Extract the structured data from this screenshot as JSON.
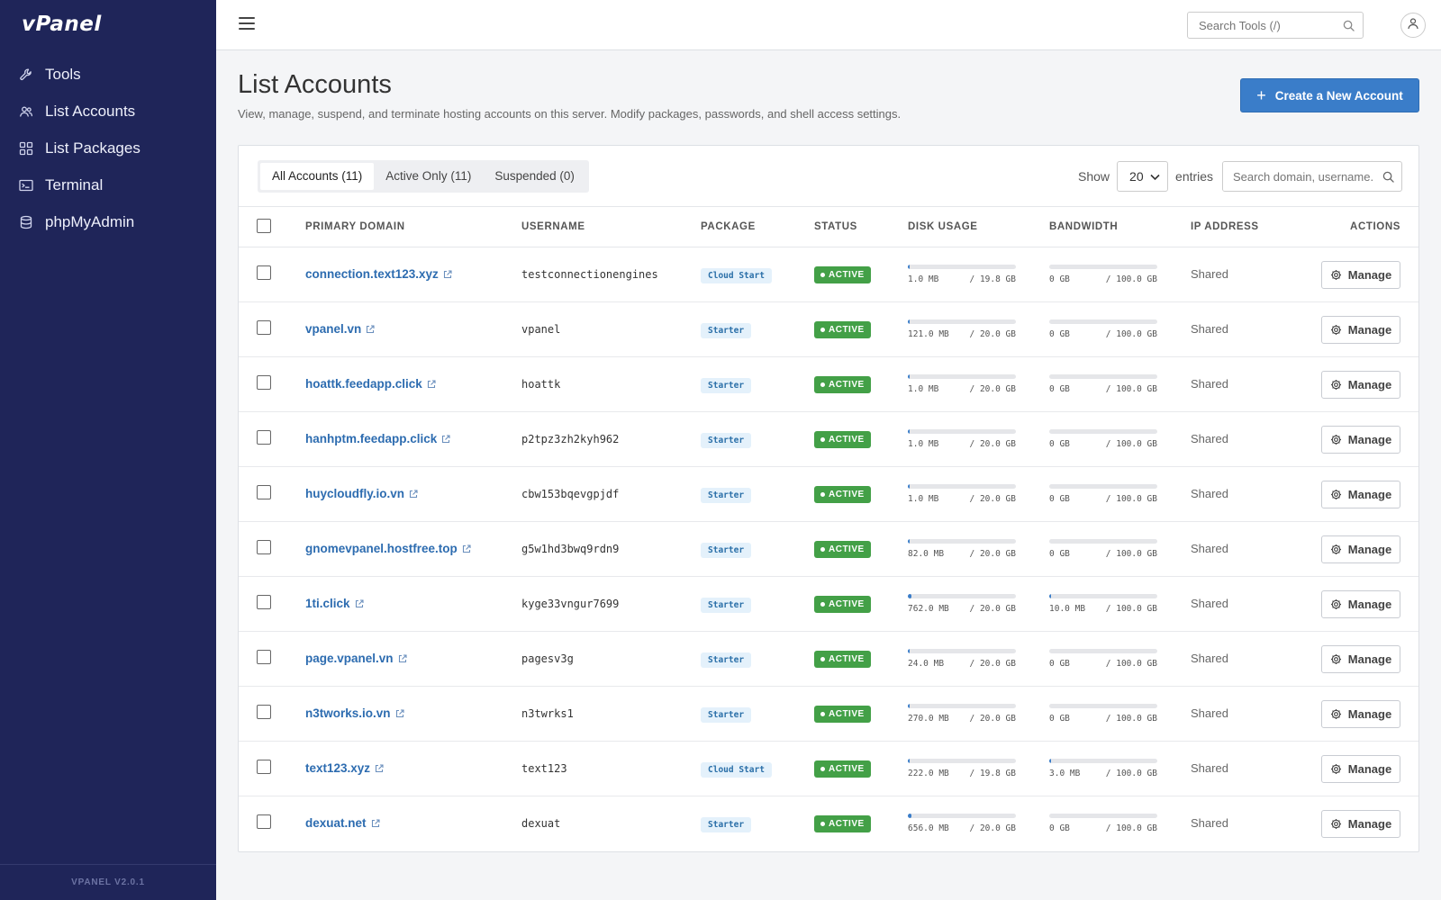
{
  "app": {
    "logo": "vPanel",
    "version": "VPANEL V2.0.1"
  },
  "sidebar": {
    "items": [
      {
        "label": "Tools",
        "icon": "wrench-icon"
      },
      {
        "label": "List Accounts",
        "icon": "users-icon"
      },
      {
        "label": "List Packages",
        "icon": "grid-icon"
      },
      {
        "label": "Terminal",
        "icon": "terminal-icon"
      },
      {
        "label": "phpMyAdmin",
        "icon": "database-icon"
      }
    ]
  },
  "topbar": {
    "search_placeholder": "Search Tools (/)"
  },
  "page": {
    "title": "List Accounts",
    "description": "View, manage, suspend, and terminate hosting accounts on this server. Modify packages, passwords, and shell access settings.",
    "create_button": "Create a New Account"
  },
  "tabs": [
    {
      "label": "All Accounts (11)",
      "active": true
    },
    {
      "label": "Active Only (11)",
      "active": false
    },
    {
      "label": "Suspended (0)",
      "active": false
    }
  ],
  "entries": {
    "show_label": "Show",
    "value": "20",
    "suffix": "entries"
  },
  "table_search": {
    "placeholder": "Search domain, username..."
  },
  "columns": [
    "PRIMARY DOMAIN",
    "USERNAME",
    "PACKAGE",
    "STATUS",
    "DISK USAGE",
    "BANDWIDTH",
    "IP ADDRESS",
    "ACTIONS"
  ],
  "rows": [
    {
      "domain": "connection.text123.xyz",
      "username": "testconnectionengines",
      "package": "Cloud Start",
      "status": "ACTIVE",
      "disk_used": "1.0 MB",
      "disk_limit": "/ 19.8 GB",
      "disk_frac": 0.0001,
      "bw_used": "0 GB",
      "bw_limit": "/ 100.0 GB",
      "bw_frac": 0,
      "ip": "Shared",
      "action": "Manage"
    },
    {
      "domain": "vpanel.vn",
      "username": "vpanel",
      "package": "Starter",
      "status": "ACTIVE",
      "disk_used": "121.0 MB",
      "disk_limit": "/ 20.0 GB",
      "disk_frac": 0.006,
      "bw_used": "0 GB",
      "bw_limit": "/ 100.0 GB",
      "bw_frac": 0,
      "ip": "Shared",
      "action": "Manage"
    },
    {
      "domain": "hoattk.feedapp.click",
      "username": "hoattk",
      "package": "Starter",
      "status": "ACTIVE",
      "disk_used": "1.0 MB",
      "disk_limit": "/ 20.0 GB",
      "disk_frac": 0.0001,
      "bw_used": "0 GB",
      "bw_limit": "/ 100.0 GB",
      "bw_frac": 0,
      "ip": "Shared",
      "action": "Manage"
    },
    {
      "domain": "hanhptm.feedapp.click",
      "username": "p2tpz3zh2kyh962",
      "package": "Starter",
      "status": "ACTIVE",
      "disk_used": "1.0 MB",
      "disk_limit": "/ 20.0 GB",
      "disk_frac": 0.0001,
      "bw_used": "0 GB",
      "bw_limit": "/ 100.0 GB",
      "bw_frac": 0,
      "ip": "Shared",
      "action": "Manage"
    },
    {
      "domain": "huycloudfly.io.vn",
      "username": "cbw153bqevgpjdf",
      "package": "Starter",
      "status": "ACTIVE",
      "disk_used": "1.0 MB",
      "disk_limit": "/ 20.0 GB",
      "disk_frac": 0.0001,
      "bw_used": "0 GB",
      "bw_limit": "/ 100.0 GB",
      "bw_frac": 0,
      "ip": "Shared",
      "action": "Manage"
    },
    {
      "domain": "gnomevpanel.hostfree.top",
      "username": "g5w1hd3bwq9rdn9",
      "package": "Starter",
      "status": "ACTIVE",
      "disk_used": "82.0 MB",
      "disk_limit": "/ 20.0 GB",
      "disk_frac": 0.004,
      "bw_used": "0 GB",
      "bw_limit": "/ 100.0 GB",
      "bw_frac": 0,
      "ip": "Shared",
      "action": "Manage"
    },
    {
      "domain": "1ti.click",
      "username": "kyge33vngur7699",
      "package": "Starter",
      "status": "ACTIVE",
      "disk_used": "762.0 MB",
      "disk_limit": "/ 20.0 GB",
      "disk_frac": 0.037,
      "bw_used": "10.0 MB",
      "bw_limit": "/ 100.0 GB",
      "bw_frac": 0.0001,
      "ip": "Shared",
      "action": "Manage"
    },
    {
      "domain": "page.vpanel.vn",
      "username": "pagesv3g",
      "package": "Starter",
      "status": "ACTIVE",
      "disk_used": "24.0 MB",
      "disk_limit": "/ 20.0 GB",
      "disk_frac": 0.0012,
      "bw_used": "0 GB",
      "bw_limit": "/ 100.0 GB",
      "bw_frac": 0,
      "ip": "Shared",
      "action": "Manage"
    },
    {
      "domain": "n3tworks.io.vn",
      "username": "n3twrks1",
      "package": "Starter",
      "status": "ACTIVE",
      "disk_used": "270.0 MB",
      "disk_limit": "/ 20.0 GB",
      "disk_frac": 0.013,
      "bw_used": "0 GB",
      "bw_limit": "/ 100.0 GB",
      "bw_frac": 0,
      "ip": "Shared",
      "action": "Manage"
    },
    {
      "domain": "text123.xyz",
      "username": "text123",
      "package": "Cloud Start",
      "status": "ACTIVE",
      "disk_used": "222.0 MB",
      "disk_limit": "/ 19.8 GB",
      "disk_frac": 0.011,
      "bw_used": "3.0 MB",
      "bw_limit": "/ 100.0 GB",
      "bw_frac": 3e-05,
      "ip": "Shared",
      "action": "Manage"
    },
    {
      "domain": "dexuat.net",
      "username": "dexuat",
      "package": "Starter",
      "status": "ACTIVE",
      "disk_used": "656.0 MB",
      "disk_limit": "/ 20.0 GB",
      "disk_frac": 0.032,
      "bw_used": "0 GB",
      "bw_limit": "/ 100.0 GB",
      "bw_frac": 0,
      "ip": "Shared",
      "action": "Manage"
    }
  ],
  "colors": {
    "sidebar": "#1f2559",
    "accent": "#3a7dc9",
    "status_active": "#43a047",
    "link": "#2d6cb0"
  }
}
